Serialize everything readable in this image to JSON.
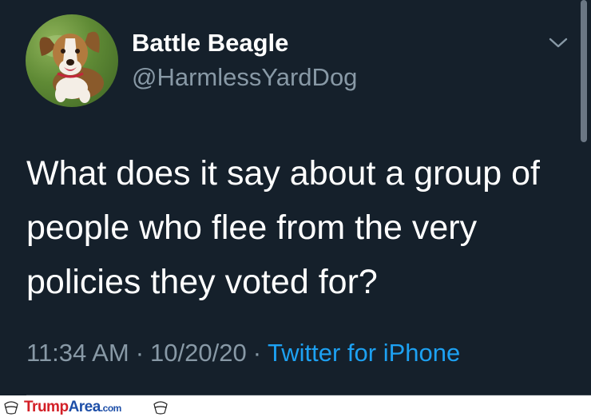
{
  "tweet": {
    "display_name": "Battle Beagle",
    "handle": "@HarmlessYardDog",
    "text": "What does it say about a group of people who flee from the very policies they voted for?",
    "time": "11:34 AM",
    "date": "10/20/20",
    "separator": "·",
    "source": "Twitter for iPhone"
  },
  "icons": {
    "caret": "chevron-down-icon",
    "avatar": "beagle-avatar"
  },
  "footer": {
    "brand_trump": "Trump",
    "brand_area": "Area",
    "brand_com": ".com"
  },
  "colors": {
    "background": "#15202b",
    "secondary_text": "#8899a6",
    "link": "#1da1f2",
    "brand_red": "#d32027",
    "brand_blue": "#1e4fa8"
  }
}
